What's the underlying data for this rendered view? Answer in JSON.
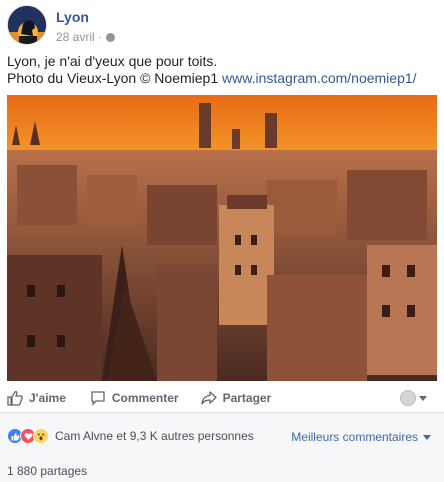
{
  "post": {
    "page_name": "Lyon",
    "date": "28 avril",
    "separator": "·",
    "caption_line1": "Lyon, je n'ai d'yeux que pour toits.",
    "caption_line2": "Photo du Vieux-Lyon © Noemiep1 ",
    "caption_link": "www.instagram.com/noemiep1/",
    "privacy_icon": "globe-icon",
    "photo_icon": "rooftops-sunset-photo"
  },
  "actions": {
    "like_label": "J'aime",
    "comment_label": "Commenter",
    "share_label": "Partager"
  },
  "reactions": {
    "icons": [
      "like-icon",
      "love-icon",
      "wow-icon"
    ],
    "text": "Cam Alvne et 9,3 K autres personnes",
    "sort_label": "Meilleurs commentaires"
  },
  "shares": {
    "text": "1 880 partages"
  },
  "colors": {
    "link": "#365899",
    "muted": "#90949c",
    "like": "#4080ff",
    "love": "#f25268",
    "wow": "#fcd75a",
    "bar_bg": "#f6f7f9"
  }
}
